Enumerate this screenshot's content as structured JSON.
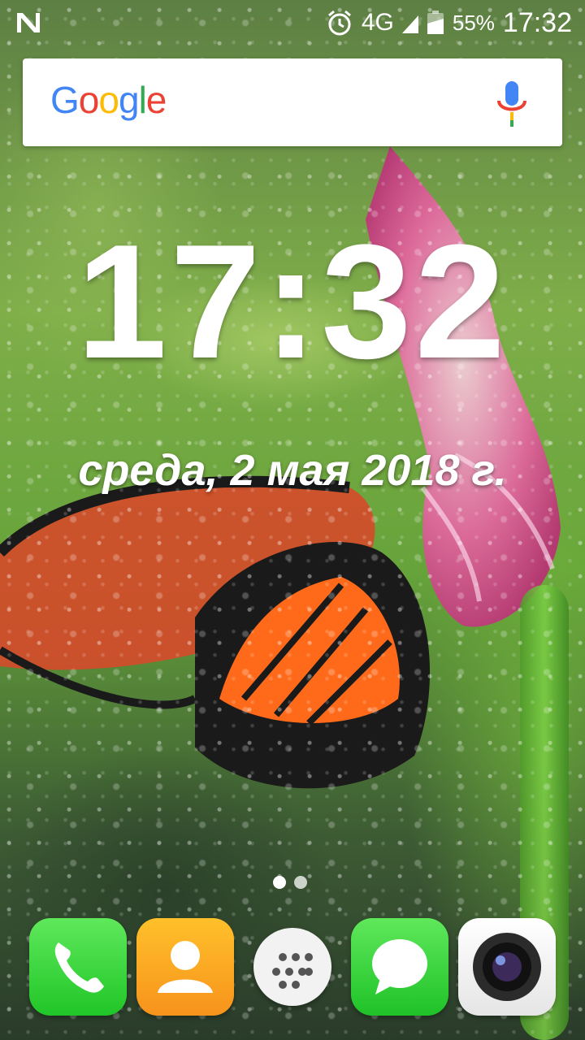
{
  "status_bar": {
    "network": "4G",
    "battery_percent": "55%",
    "time": "17:32",
    "icons": [
      "n-notification-icon",
      "alarm-icon",
      "signal-icon",
      "battery-icon"
    ]
  },
  "search": {
    "logo_letters": [
      "G",
      "o",
      "o",
      "g",
      "l",
      "e"
    ],
    "colors": {
      "blue": "#4285F4",
      "red": "#EA4335",
      "yellow": "#FBBC05",
      "green": "#34A853"
    },
    "mic_icon": "microphone-icon"
  },
  "clock": {
    "time": "17:32",
    "date": "среда, 2 мая 2018 г."
  },
  "pager": {
    "pages": 2,
    "current": 1
  },
  "dock": {
    "apps": [
      {
        "name": "phone",
        "icon": "phone-icon"
      },
      {
        "name": "contacts",
        "icon": "contacts-icon"
      },
      {
        "name": "app-drawer",
        "icon": "app-drawer-icon"
      },
      {
        "name": "messages",
        "icon": "messages-icon"
      },
      {
        "name": "camera",
        "icon": "camera-icon"
      }
    ]
  }
}
